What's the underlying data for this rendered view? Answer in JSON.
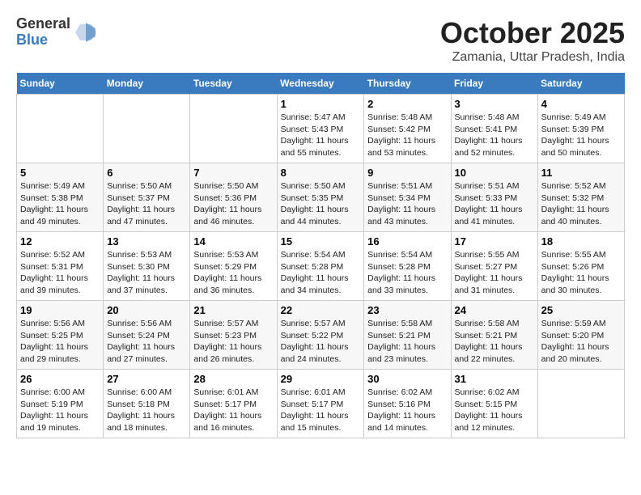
{
  "logo": {
    "general": "General",
    "blue": "Blue"
  },
  "title": "October 2025",
  "location": "Zamania, Uttar Pradesh, India",
  "days_of_week": [
    "Sunday",
    "Monday",
    "Tuesday",
    "Wednesday",
    "Thursday",
    "Friday",
    "Saturday"
  ],
  "weeks": [
    [
      {
        "num": "",
        "sunrise": "",
        "sunset": "",
        "daylight": ""
      },
      {
        "num": "",
        "sunrise": "",
        "sunset": "",
        "daylight": ""
      },
      {
        "num": "",
        "sunrise": "",
        "sunset": "",
        "daylight": ""
      },
      {
        "num": "1",
        "sunrise": "Sunrise: 5:47 AM",
        "sunset": "Sunset: 5:43 PM",
        "daylight": "Daylight: 11 hours and 55 minutes."
      },
      {
        "num": "2",
        "sunrise": "Sunrise: 5:48 AM",
        "sunset": "Sunset: 5:42 PM",
        "daylight": "Daylight: 11 hours and 53 minutes."
      },
      {
        "num": "3",
        "sunrise": "Sunrise: 5:48 AM",
        "sunset": "Sunset: 5:41 PM",
        "daylight": "Daylight: 11 hours and 52 minutes."
      },
      {
        "num": "4",
        "sunrise": "Sunrise: 5:49 AM",
        "sunset": "Sunset: 5:39 PM",
        "daylight": "Daylight: 11 hours and 50 minutes."
      }
    ],
    [
      {
        "num": "5",
        "sunrise": "Sunrise: 5:49 AM",
        "sunset": "Sunset: 5:38 PM",
        "daylight": "Daylight: 11 hours and 49 minutes."
      },
      {
        "num": "6",
        "sunrise": "Sunrise: 5:50 AM",
        "sunset": "Sunset: 5:37 PM",
        "daylight": "Daylight: 11 hours and 47 minutes."
      },
      {
        "num": "7",
        "sunrise": "Sunrise: 5:50 AM",
        "sunset": "Sunset: 5:36 PM",
        "daylight": "Daylight: 11 hours and 46 minutes."
      },
      {
        "num": "8",
        "sunrise": "Sunrise: 5:50 AM",
        "sunset": "Sunset: 5:35 PM",
        "daylight": "Daylight: 11 hours and 44 minutes."
      },
      {
        "num": "9",
        "sunrise": "Sunrise: 5:51 AM",
        "sunset": "Sunset: 5:34 PM",
        "daylight": "Daylight: 11 hours and 43 minutes."
      },
      {
        "num": "10",
        "sunrise": "Sunrise: 5:51 AM",
        "sunset": "Sunset: 5:33 PM",
        "daylight": "Daylight: 11 hours and 41 minutes."
      },
      {
        "num": "11",
        "sunrise": "Sunrise: 5:52 AM",
        "sunset": "Sunset: 5:32 PM",
        "daylight": "Daylight: 11 hours and 40 minutes."
      }
    ],
    [
      {
        "num": "12",
        "sunrise": "Sunrise: 5:52 AM",
        "sunset": "Sunset: 5:31 PM",
        "daylight": "Daylight: 11 hours and 39 minutes."
      },
      {
        "num": "13",
        "sunrise": "Sunrise: 5:53 AM",
        "sunset": "Sunset: 5:30 PM",
        "daylight": "Daylight: 11 hours and 37 minutes."
      },
      {
        "num": "14",
        "sunrise": "Sunrise: 5:53 AM",
        "sunset": "Sunset: 5:29 PM",
        "daylight": "Daylight: 11 hours and 36 minutes."
      },
      {
        "num": "15",
        "sunrise": "Sunrise: 5:54 AM",
        "sunset": "Sunset: 5:28 PM",
        "daylight": "Daylight: 11 hours and 34 minutes."
      },
      {
        "num": "16",
        "sunrise": "Sunrise: 5:54 AM",
        "sunset": "Sunset: 5:28 PM",
        "daylight": "Daylight: 11 hours and 33 minutes."
      },
      {
        "num": "17",
        "sunrise": "Sunrise: 5:55 AM",
        "sunset": "Sunset: 5:27 PM",
        "daylight": "Daylight: 11 hours and 31 minutes."
      },
      {
        "num": "18",
        "sunrise": "Sunrise: 5:55 AM",
        "sunset": "Sunset: 5:26 PM",
        "daylight": "Daylight: 11 hours and 30 minutes."
      }
    ],
    [
      {
        "num": "19",
        "sunrise": "Sunrise: 5:56 AM",
        "sunset": "Sunset: 5:25 PM",
        "daylight": "Daylight: 11 hours and 29 minutes."
      },
      {
        "num": "20",
        "sunrise": "Sunrise: 5:56 AM",
        "sunset": "Sunset: 5:24 PM",
        "daylight": "Daylight: 11 hours and 27 minutes."
      },
      {
        "num": "21",
        "sunrise": "Sunrise: 5:57 AM",
        "sunset": "Sunset: 5:23 PM",
        "daylight": "Daylight: 11 hours and 26 minutes."
      },
      {
        "num": "22",
        "sunrise": "Sunrise: 5:57 AM",
        "sunset": "Sunset: 5:22 PM",
        "daylight": "Daylight: 11 hours and 24 minutes."
      },
      {
        "num": "23",
        "sunrise": "Sunrise: 5:58 AM",
        "sunset": "Sunset: 5:21 PM",
        "daylight": "Daylight: 11 hours and 23 minutes."
      },
      {
        "num": "24",
        "sunrise": "Sunrise: 5:58 AM",
        "sunset": "Sunset: 5:21 PM",
        "daylight": "Daylight: 11 hours and 22 minutes."
      },
      {
        "num": "25",
        "sunrise": "Sunrise: 5:59 AM",
        "sunset": "Sunset: 5:20 PM",
        "daylight": "Daylight: 11 hours and 20 minutes."
      }
    ],
    [
      {
        "num": "26",
        "sunrise": "Sunrise: 6:00 AM",
        "sunset": "Sunset: 5:19 PM",
        "daylight": "Daylight: 11 hours and 19 minutes."
      },
      {
        "num": "27",
        "sunrise": "Sunrise: 6:00 AM",
        "sunset": "Sunset: 5:18 PM",
        "daylight": "Daylight: 11 hours and 18 minutes."
      },
      {
        "num": "28",
        "sunrise": "Sunrise: 6:01 AM",
        "sunset": "Sunset: 5:17 PM",
        "daylight": "Daylight: 11 hours and 16 minutes."
      },
      {
        "num": "29",
        "sunrise": "Sunrise: 6:01 AM",
        "sunset": "Sunset: 5:17 PM",
        "daylight": "Daylight: 11 hours and 15 minutes."
      },
      {
        "num": "30",
        "sunrise": "Sunrise: 6:02 AM",
        "sunset": "Sunset: 5:16 PM",
        "daylight": "Daylight: 11 hours and 14 minutes."
      },
      {
        "num": "31",
        "sunrise": "Sunrise: 6:02 AM",
        "sunset": "Sunset: 5:15 PM",
        "daylight": "Daylight: 11 hours and 12 minutes."
      },
      {
        "num": "",
        "sunrise": "",
        "sunset": "",
        "daylight": ""
      }
    ]
  ]
}
